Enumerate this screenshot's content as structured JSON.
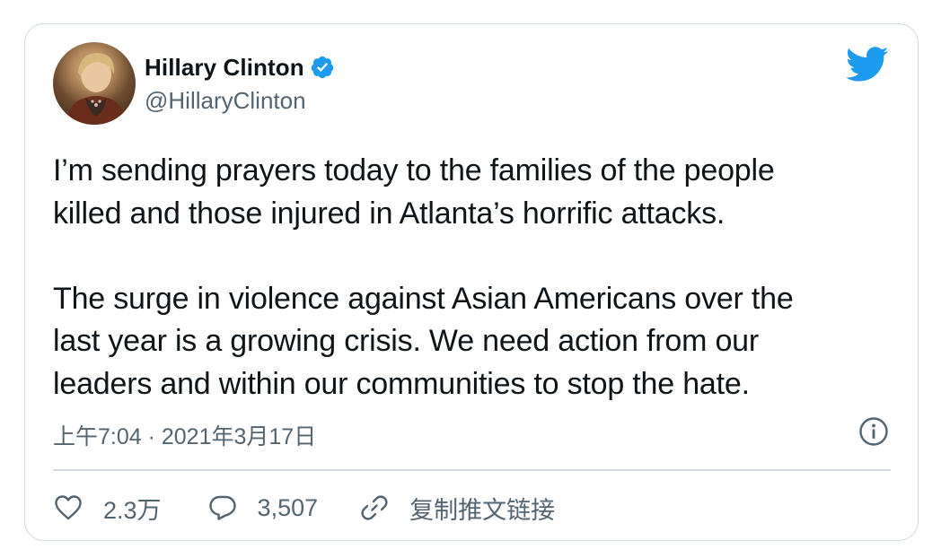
{
  "author": {
    "display_name": "Hillary Clinton",
    "handle": "@HillaryClinton",
    "verified": true,
    "avatar": "profile-photo"
  },
  "tweet": {
    "text": "I’m sending prayers today to the families of the people\nkilled and those injured in Atlanta’s horrific attacks.\n\nThe surge in violence against Asian Americans over the\nlast year is a growing crisis. We need action from our\nleaders and within our communities to stop the hate.",
    "timestamp": "上午7:04 · 2021年3月17日"
  },
  "actions": {
    "likes": "2.3万",
    "replies": "3,507",
    "copy_link": "复制推文链接"
  },
  "icons": {
    "brand": "twitter-bird-icon",
    "verified": "verified-badge-icon",
    "info": "info-icon",
    "like": "heart-icon",
    "reply": "reply-bubble-icon",
    "link": "link-icon"
  },
  "colors": {
    "twitter_blue": "#1d9bf0",
    "text_primary": "#0f1419",
    "text_secondary": "#536471",
    "border": "#cfd9de"
  }
}
